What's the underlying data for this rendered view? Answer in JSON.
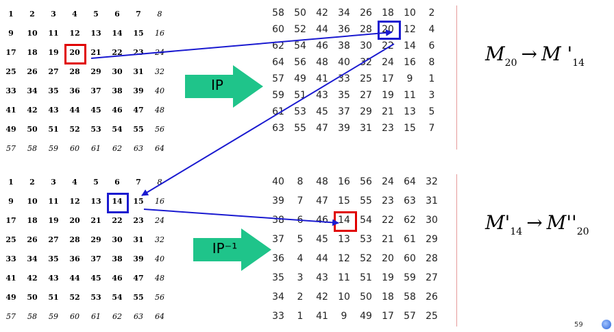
{
  "grid_top_left": {
    "rows": [
      [
        "1",
        "2",
        "3",
        "4",
        "5",
        "6",
        "7",
        "8"
      ],
      [
        "9",
        "10",
        "11",
        "12",
        "13",
        "14",
        "15",
        "16"
      ],
      [
        "17",
        "18",
        "19",
        "20",
        "21",
        "22",
        "23",
        "24"
      ],
      [
        "25",
        "26",
        "27",
        "28",
        "29",
        "30",
        "31",
        "32"
      ],
      [
        "33",
        "34",
        "35",
        "36",
        "37",
        "38",
        "39",
        "40"
      ],
      [
        "41",
        "42",
        "43",
        "44",
        "45",
        "46",
        "47",
        "48"
      ],
      [
        "49",
        "50",
        "51",
        "52",
        "53",
        "54",
        "55",
        "56"
      ],
      [
        "57",
        "58",
        "59",
        "60",
        "61",
        "62",
        "63",
        "64"
      ]
    ],
    "highlight": {
      "row": 2,
      "col": 3,
      "color": "#e00000"
    }
  },
  "grid_top_right": {
    "rows": [
      [
        "58",
        "50",
        "42",
        "34",
        "26",
        "18",
        "10",
        "2"
      ],
      [
        "60",
        "52",
        "44",
        "36",
        "28",
        "20",
        "12",
        "4"
      ],
      [
        "62",
        "54",
        "46",
        "38",
        "30",
        "22",
        "14",
        "6"
      ],
      [
        "64",
        "56",
        "48",
        "40",
        "32",
        "24",
        "16",
        "8"
      ],
      [
        "57",
        "49",
        "41",
        "33",
        "25",
        "17",
        "9",
        "1"
      ],
      [
        "59",
        "51",
        "43",
        "35",
        "27",
        "19",
        "11",
        "3"
      ],
      [
        "61",
        "53",
        "45",
        "37",
        "29",
        "21",
        "13",
        "5"
      ],
      [
        "63",
        "55",
        "47",
        "39",
        "31",
        "23",
        "15",
        "7"
      ]
    ],
    "highlight": {
      "row": 1,
      "col": 5,
      "color": "#1a1ad0"
    }
  },
  "grid_bottom_left": {
    "rows": [
      [
        "1",
        "2",
        "3",
        "4",
        "5",
        "6",
        "7",
        "8"
      ],
      [
        "9",
        "10",
        "11",
        "12",
        "13",
        "14",
        "15",
        "16"
      ],
      [
        "17",
        "18",
        "19",
        "20",
        "21",
        "22",
        "23",
        "24"
      ],
      [
        "25",
        "26",
        "27",
        "28",
        "29",
        "30",
        "31",
        "32"
      ],
      [
        "33",
        "34",
        "35",
        "36",
        "37",
        "38",
        "39",
        "40"
      ],
      [
        "41",
        "42",
        "43",
        "44",
        "45",
        "46",
        "47",
        "48"
      ],
      [
        "49",
        "50",
        "51",
        "52",
        "53",
        "54",
        "55",
        "56"
      ],
      [
        "57",
        "58",
        "59",
        "60",
        "61",
        "62",
        "63",
        "64"
      ]
    ],
    "highlight": {
      "row": 1,
      "col": 5,
      "color": "#1a1ad0"
    }
  },
  "grid_bottom_right": {
    "rows": [
      [
        "40",
        "8",
        "48",
        "16",
        "56",
        "24",
        "64",
        "32"
      ],
      [
        "39",
        "7",
        "47",
        "15",
        "55",
        "23",
        "63",
        "31"
      ],
      [
        "38",
        "6",
        "46",
        "14",
        "54",
        "22",
        "62",
        "30"
      ],
      [
        "37",
        "5",
        "45",
        "13",
        "53",
        "21",
        "61",
        "29"
      ],
      [
        "36",
        "4",
        "44",
        "12",
        "52",
        "20",
        "60",
        "28"
      ],
      [
        "35",
        "3",
        "43",
        "11",
        "51",
        "19",
        "59",
        "27"
      ],
      [
        "34",
        "2",
        "42",
        "10",
        "50",
        "18",
        "58",
        "26"
      ],
      [
        "33",
        "1",
        "41",
        "9",
        "49",
        "17",
        "57",
        "25"
      ]
    ],
    "highlight": {
      "row": 2,
      "col": 3,
      "color": "#e00000"
    }
  },
  "arrows": {
    "ip_label": "IP",
    "ip_inverse_label": "IP⁻¹",
    "fill_color": "#1fc48a"
  },
  "formula_top": {
    "m": "M",
    "sub1": "20",
    "arrow": "→",
    "m2": "M '",
    "sub2": "14"
  },
  "formula_bottom": {
    "m": "M'",
    "sub1": "14",
    "arrow": "→",
    "m2": "M''",
    "sub2": "20"
  },
  "page_number": "59"
}
